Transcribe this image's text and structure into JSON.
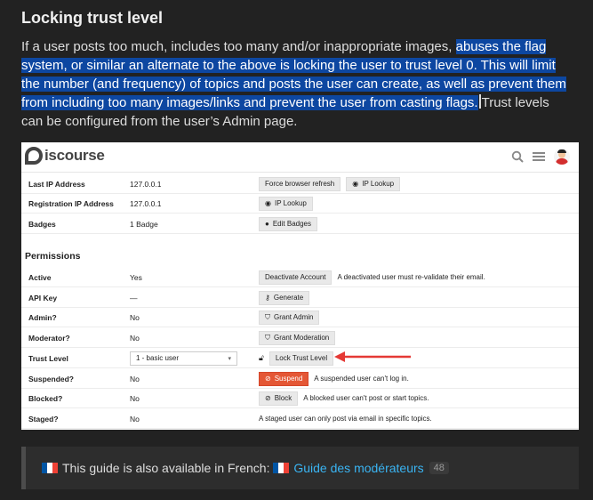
{
  "heading": "Locking trust level",
  "paragraph": {
    "plain_start": "If a user posts too much, includes too many and/or inappropriate images, ",
    "highlighted": "abuses the flag system, or similar an alternate to the above is locking the user to trust level 0. This will limit the number (and frequency) of topics and posts the user can create, as well as prevent them from including too many images/links and prevent the user from casting flags.",
    "plain_end": "Trust levels can be configured from the user’s Admin page."
  },
  "screenshot": {
    "logo_text": "iscourse",
    "icons": [
      "search-icon",
      "hamburger-menu-icon",
      "user-avatar"
    ],
    "rows_top": [
      {
        "label": "Last IP Address",
        "value": "127.0.0.1",
        "buttons": [
          "Force browser refresh",
          "IP Lookup"
        ]
      },
      {
        "label": "Registration IP Address",
        "value": "127.0.0.1",
        "buttons": [
          "IP Lookup"
        ]
      },
      {
        "label": "Badges",
        "value": "1 Badge",
        "buttons": [
          "Edit Badges"
        ]
      }
    ],
    "permissions_title": "Permissions",
    "active": {
      "label": "Active",
      "value": "Yes",
      "button": "Deactivate Account",
      "note": "A deactivated user must re-validate their email."
    },
    "api_key": {
      "label": "API Key",
      "value": "—",
      "button": "Generate"
    },
    "admin": {
      "label": "Admin?",
      "value": "No",
      "button": "Grant Admin"
    },
    "moderator": {
      "label": "Moderator?",
      "value": "No",
      "button": "Grant Moderation"
    },
    "trust_level": {
      "label": "Trust Level",
      "selected": "1 - basic user",
      "button": "Lock Trust Level"
    },
    "suspended": {
      "label": "Suspended?",
      "value": "No",
      "button": "Suspend",
      "note": "A suspended user can't log in."
    },
    "blocked": {
      "label": "Blocked?",
      "value": "No",
      "button": "Block",
      "note": "A blocked user can't post or start topics."
    },
    "staged": {
      "label": "Staged?",
      "value": "No",
      "note": "A staged user can only post via email in specific topics."
    },
    "colors": {
      "danger": "#e45735",
      "arrow": "#e53935"
    }
  },
  "callout": {
    "text": "This guide is also available in French:",
    "link": "Guide des modérateurs",
    "count": "48",
    "flag_colors": [
      "#0055a4",
      "#ffffff",
      "#ef4135"
    ]
  }
}
